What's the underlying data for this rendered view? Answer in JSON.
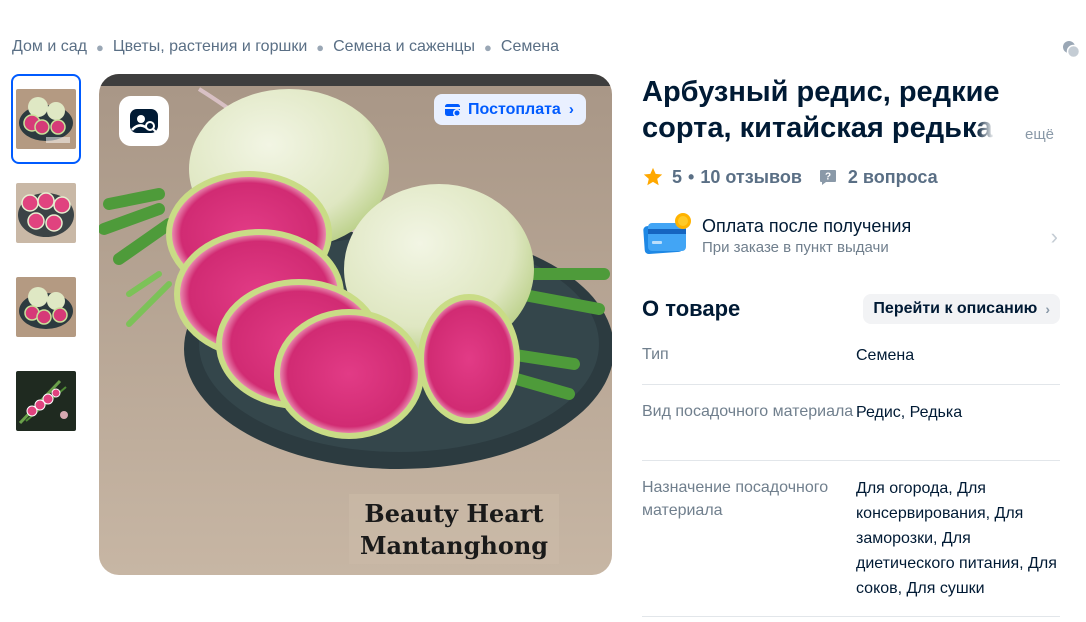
{
  "breadcrumb": [
    "Дом и сад",
    "Цветы, растения и горшки",
    "Семена и саженцы",
    "Семена"
  ],
  "gallery": {
    "thumbnails": [
      {
        "name": "thumb-1",
        "active": true
      },
      {
        "name": "thumb-2",
        "active": false
      },
      {
        "name": "thumb-3",
        "active": false
      },
      {
        "name": "thumb-4",
        "active": false
      }
    ],
    "badge_label": "Постоплата",
    "watermark_line1": "Beauty Heart",
    "watermark_line2": "Mantanghong",
    "lens_icon": "image-search-icon"
  },
  "product": {
    "title_line1": "Арбузный редис, редкие",
    "title_line2_visible": "сорта, китайская редьк",
    "title_line2_fade": "а",
    "more_label": "ещё",
    "rating": "5",
    "reviews": "10 отзывов",
    "questions": "2 вопроса",
    "rating_separator": "•"
  },
  "payment": {
    "title": "Оплата после получения",
    "subtitle": "При заказе в пункт выдачи"
  },
  "about": {
    "title": "О товаре",
    "goto_label": "Перейти к описанию",
    "specs": [
      {
        "key": "Тип",
        "value": "Семена"
      },
      {
        "key": "Вид посадочного материала",
        "value": "Редис, Редька"
      },
      {
        "key": "Назначение посадочного материала",
        "value": "Для огорода, Для консервирования, Для заморозки, Для диетического питания, Для соков, Для сушки"
      }
    ]
  },
  "colors": {
    "accent": "#005bff",
    "star": "#ffa800",
    "text_primary": "#001a34",
    "text_secondary": "#707f8d"
  }
}
